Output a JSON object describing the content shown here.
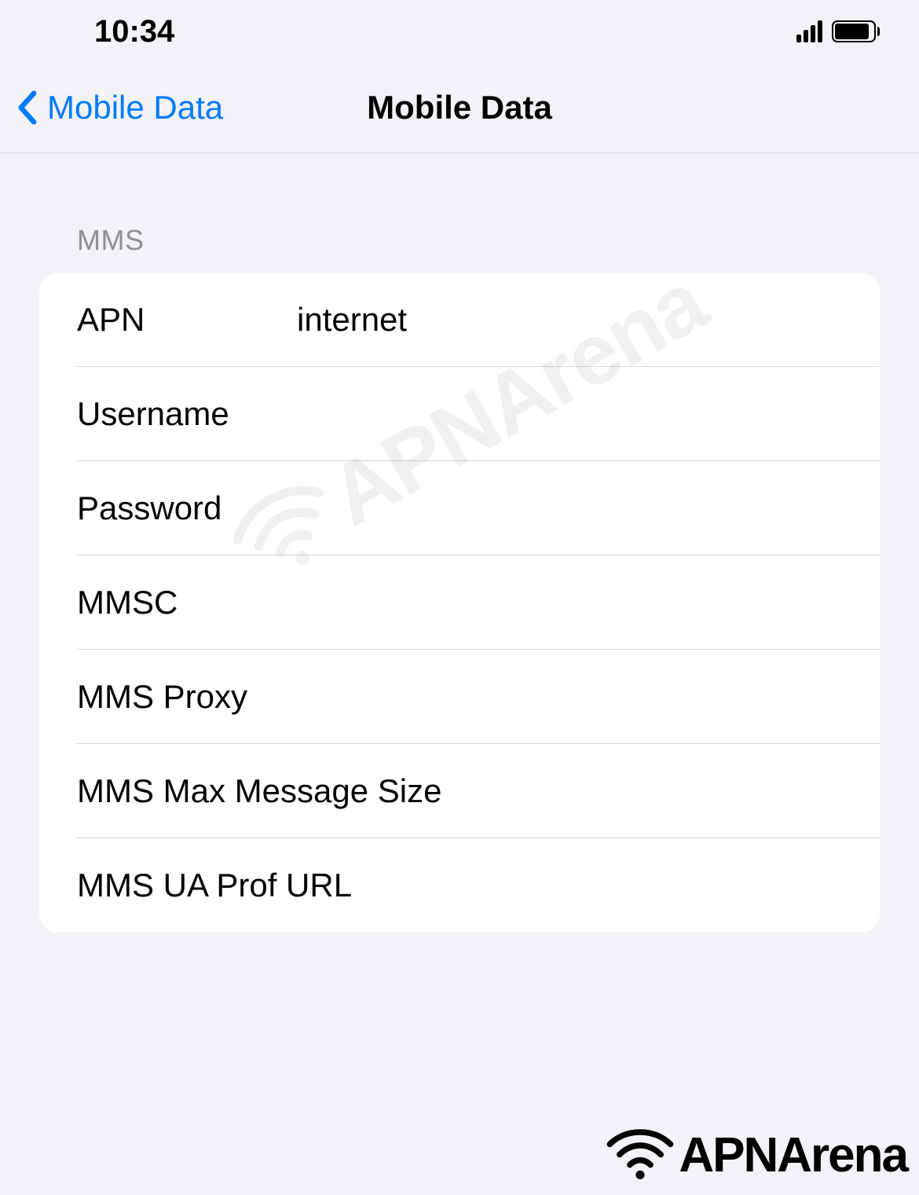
{
  "status_bar": {
    "time": "10:34"
  },
  "nav": {
    "back_label": "Mobile Data",
    "title": "Mobile Data"
  },
  "section": {
    "header": "MMS",
    "rows": [
      {
        "label": "APN",
        "value": "internet"
      },
      {
        "label": "Username",
        "value": ""
      },
      {
        "label": "Password",
        "value": ""
      },
      {
        "label": "MMSC",
        "value": ""
      },
      {
        "label": "MMS Proxy",
        "value": ""
      },
      {
        "label": "MMS Max Message Size",
        "value": ""
      },
      {
        "label": "MMS UA Prof URL",
        "value": ""
      }
    ]
  },
  "watermark": "APNArena",
  "footer": "APNArena"
}
